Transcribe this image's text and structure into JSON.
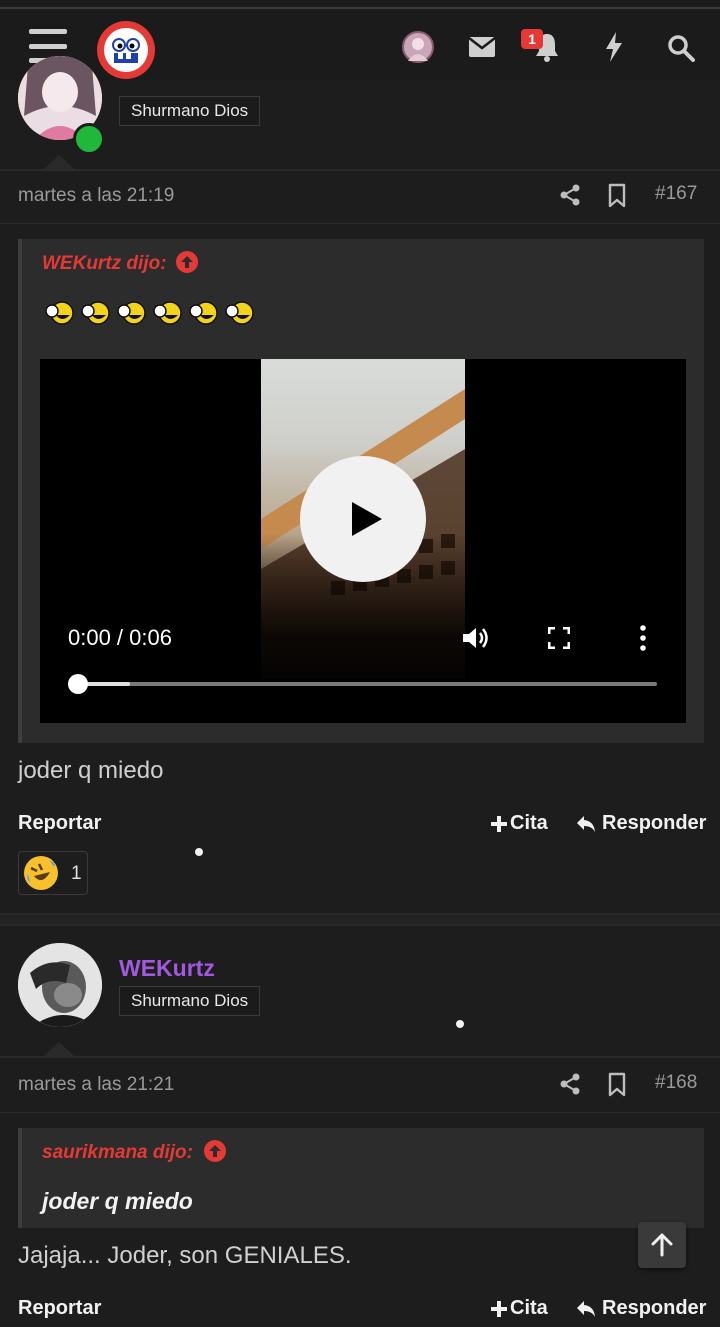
{
  "navbar": {
    "menu_icon": "hamburger-menu-icon",
    "logo_icon": "forocoches-logo",
    "avatar_icon": "user-avatar",
    "mail_icon": "envelope-icon",
    "alert_icon": "bell-icon",
    "alert_count": "1",
    "whats_new_icon": "lightning-bolt-icon",
    "search_icon": "magnifier-icon"
  },
  "posts": [
    {
      "rank": "Shurmano Dios",
      "date": "martes a las 21:19",
      "number": "#167",
      "quote": {
        "author": "WEKurtz dijo:",
        "emoji_count": 6
      },
      "video": {
        "time": "0:00 / 0:06",
        "progress_buffered": 0.09
      },
      "text": "joder q miedo",
      "actions": {
        "report": "Reportar",
        "quote": "Cita",
        "reply": "Responder"
      },
      "reaction": {
        "icon": "rofl-emoji",
        "count": "1"
      }
    },
    {
      "username": "WEKurtz",
      "rank": "Shurmano Dios",
      "date": "martes a las 21:21",
      "number": "#168",
      "quote": {
        "author": "saurikmana dijo:",
        "text": "joder q miedo"
      },
      "text": "Jajaja... Joder, son GENIALES.",
      "actions": {
        "report": "Reportar",
        "quote": "Cita",
        "reply": "Responder"
      }
    }
  ],
  "colors": {
    "background": "#1d1d1d",
    "accent_red": "#e53935",
    "username_purple": "#a259e0",
    "online_green": "#1fb83a"
  }
}
